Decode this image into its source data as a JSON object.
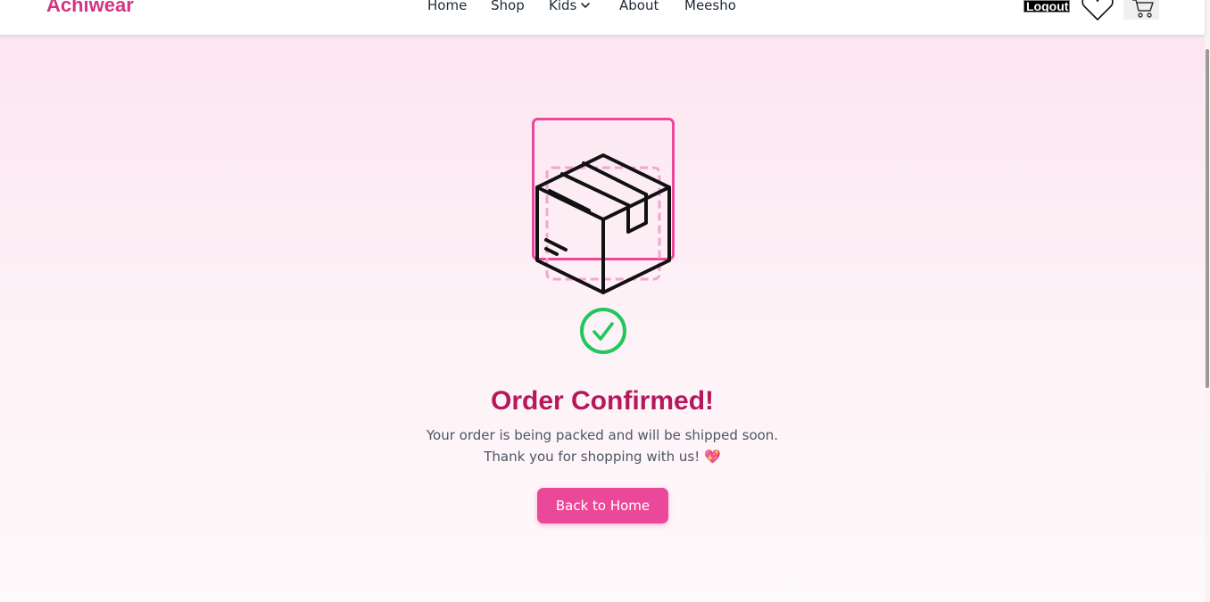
{
  "header": {
    "brand": "Achiwear",
    "nav": {
      "home": "Home",
      "shop": "Shop",
      "kids": "Kids",
      "about": "About",
      "meesho": "Meesho"
    },
    "logout_label": "Logout",
    "wishlist_icon": "heart-icon",
    "cart_icon": "cart-icon"
  },
  "main": {
    "illustration_icon": "package-box-icon",
    "status_icon": "check-circle-icon",
    "title": "Order Confirmed!",
    "message_line1": "Your order is being packed and will be shipped soon.",
    "message_line2": "Thank you for shopping with us!",
    "message_emoji": "💖",
    "button_label": "Back to Home"
  },
  "colors": {
    "brand": "#d63384",
    "title": "#b5185c",
    "button": "#ec4899",
    "check": "#22c55e",
    "illustration_frame": "#ec4899",
    "illustration_dashed": "#f4a6cf"
  }
}
